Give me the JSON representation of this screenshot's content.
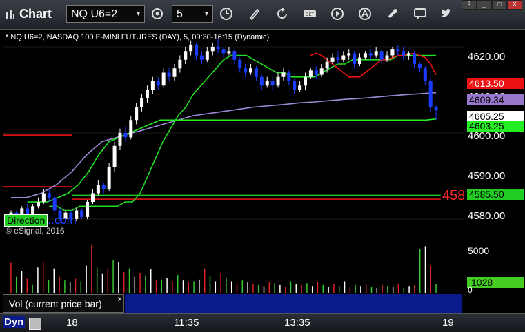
{
  "toolbar": {
    "app_title": "Chart",
    "symbol_value": "NQ U6=2",
    "interval_value": "5",
    "icons": [
      "settings-icon",
      "clock-icon",
      "pencil-icon",
      "refresh-icon",
      "get-icon",
      "play-icon",
      "alert-icon",
      "link-icon",
      "comment-icon",
      "twitter-icon"
    ]
  },
  "window_controls": [
    "?",
    "_",
    "□",
    "X"
  ],
  "legend": {
    "header": "* NQ U6=2, NASDAQ 100 E-MINI FUTURES (DAY), 5, 09:30-16:15 (Dynamic)",
    "copyright": "© eSignal, 2016",
    "watermark_box": "Direction",
    "watermark_tail": "..com"
  },
  "price_axis": {
    "labels": [
      "4620.00",
      "4610.00",
      "4600.00",
      "4590.00",
      "4580.00"
    ],
    "tags": [
      {
        "text": "4613.50",
        "bg": "#ee1111",
        "fg": "#ffffff"
      },
      {
        "text": "4609.34",
        "bg": "#9977cc",
        "fg": "#000000"
      },
      {
        "text": "4605.25",
        "bg": "#ffffff",
        "fg": "#000000"
      },
      {
        "text": "4603.25",
        "bg": "#22ee22",
        "fg": "#000000"
      },
      {
        "text": "4585.50",
        "bg": "#22cc22",
        "fg": "#000000"
      }
    ],
    "side_number": "458"
  },
  "volume_axis": {
    "top_label": "5000",
    "value_tag": "1028",
    "zero_label": "0"
  },
  "bottom": {
    "volume_tab": "Vol (current price bar)",
    "close": "×",
    "dyn": "Dyn",
    "times": [
      "18",
      "11:35",
      "13:35",
      "19"
    ]
  },
  "chart_data": {
    "type": "candlestick",
    "ylim": [
      4576,
      4624
    ],
    "ticks": [
      4620,
      4610,
      4600,
      4590,
      4580
    ],
    "levels": [
      {
        "price": 4599.5,
        "color": "#cc1111",
        "from": 0.0,
        "to": 0.15
      },
      {
        "price": 4587.5,
        "color": "#cc1111",
        "from": 0.0,
        "to": 0.15
      },
      {
        "price": 4585.5,
        "color": "#22cc22",
        "from": 0.15,
        "to": 0.95
      },
      {
        "price": 4584.6,
        "color": "#cc1111",
        "from": 0.15,
        "to": 0.95
      }
    ],
    "candles": [
      {
        "o": 4580.5,
        "c": 4581.5,
        "h": 4582,
        "l": 4580
      },
      {
        "o": 4581.5,
        "c": 4580.5,
        "h": 4582,
        "l": 4579.5
      },
      {
        "o": 4580.5,
        "c": 4582.5,
        "h": 4583,
        "l": 4580
      },
      {
        "o": 4582.5,
        "c": 4581,
        "h": 4583.5,
        "l": 4580.5
      },
      {
        "o": 4581,
        "c": 4583,
        "h": 4583.5,
        "l": 4580.5
      },
      {
        "o": 4583,
        "c": 4584,
        "h": 4585,
        "l": 4582.5
      },
      {
        "o": 4584,
        "c": 4586,
        "h": 4587,
        "l": 4583.5
      },
      {
        "o": 4586,
        "c": 4585,
        "h": 4587,
        "l": 4584
      },
      {
        "o": 4585,
        "c": 4582,
        "h": 4585.5,
        "l": 4581
      },
      {
        "o": 4582,
        "c": 4580,
        "h": 4582.5,
        "l": 4579
      },
      {
        "o": 4580,
        "c": 4581.5,
        "h": 4582,
        "l": 4579.5
      },
      {
        "o": 4581.5,
        "c": 4580,
        "h": 4582,
        "l": 4579
      },
      {
        "o": 4580,
        "c": 4582,
        "h": 4582.5,
        "l": 4579.5
      },
      {
        "o": 4582,
        "c": 4580.5,
        "h": 4582.5,
        "l": 4580
      },
      {
        "o": 4580.5,
        "c": 4584,
        "h": 4584.5,
        "l": 4580
      },
      {
        "o": 4584,
        "c": 4586,
        "h": 4587,
        "l": 4583.5
      },
      {
        "o": 4586,
        "c": 4588,
        "h": 4589,
        "l": 4585.5
      },
      {
        "o": 4588,
        "c": 4587,
        "h": 4588.5,
        "l": 4586
      },
      {
        "o": 4587,
        "c": 4592,
        "h": 4593,
        "l": 4586.5
      },
      {
        "o": 4592,
        "c": 4597,
        "h": 4598,
        "l": 4591
      },
      {
        "o": 4597,
        "c": 4600,
        "h": 4601,
        "l": 4596
      },
      {
        "o": 4600,
        "c": 4599,
        "h": 4601.5,
        "l": 4598
      },
      {
        "o": 4599,
        "c": 4603,
        "h": 4604,
        "l": 4598.5
      },
      {
        "o": 4603,
        "c": 4606,
        "h": 4607,
        "l": 4602
      },
      {
        "o": 4606,
        "c": 4608,
        "h": 4609,
        "l": 4605
      },
      {
        "o": 4608,
        "c": 4610,
        "h": 4611,
        "l": 4607
      },
      {
        "o": 4610,
        "c": 4612,
        "h": 4613,
        "l": 4609
      },
      {
        "o": 4612,
        "c": 4611,
        "h": 4613,
        "l": 4610
      },
      {
        "o": 4611,
        "c": 4614,
        "h": 4615,
        "l": 4610.5
      },
      {
        "o": 4614,
        "c": 4613,
        "h": 4615,
        "l": 4612
      },
      {
        "o": 4613,
        "c": 4615,
        "h": 4616,
        "l": 4612
      },
      {
        "o": 4615,
        "c": 4617,
        "h": 4618,
        "l": 4614
      },
      {
        "o": 4617,
        "c": 4619,
        "h": 4620,
        "l": 4616
      },
      {
        "o": 4619,
        "c": 4620.5,
        "h": 4621.5,
        "l": 4618
      },
      {
        "o": 4620.5,
        "c": 4618,
        "h": 4621,
        "l": 4617
      },
      {
        "o": 4618,
        "c": 4617,
        "h": 4619,
        "l": 4616
      },
      {
        "o": 4617,
        "c": 4619,
        "h": 4620,
        "l": 4616.5
      },
      {
        "o": 4619,
        "c": 4620,
        "h": 4621,
        "l": 4618
      },
      {
        "o": 4620,
        "c": 4619.5,
        "h": 4622,
        "l": 4618.5
      },
      {
        "o": 4619.5,
        "c": 4618.5,
        "h": 4620,
        "l": 4617.5
      },
      {
        "o": 4618.5,
        "c": 4619,
        "h": 4620,
        "l": 4618
      },
      {
        "o": 4619,
        "c": 4617,
        "h": 4619.5,
        "l": 4616
      },
      {
        "o": 4617,
        "c": 4615,
        "h": 4617.5,
        "l": 4614
      },
      {
        "o": 4615,
        "c": 4614,
        "h": 4616,
        "l": 4613
      },
      {
        "o": 4614,
        "c": 4615,
        "h": 4616,
        "l": 4613.5
      },
      {
        "o": 4615,
        "c": 4613,
        "h": 4615.5,
        "l": 4612
      },
      {
        "o": 4613,
        "c": 4611,
        "h": 4613.5,
        "l": 4610
      },
      {
        "o": 4611,
        "c": 4612,
        "h": 4613,
        "l": 4610.5
      },
      {
        "o": 4612,
        "c": 4611,
        "h": 4613,
        "l": 4610
      },
      {
        "o": 4611,
        "c": 4613,
        "h": 4614,
        "l": 4610.5
      },
      {
        "o": 4613,
        "c": 4614,
        "h": 4615,
        "l": 4612
      },
      {
        "o": 4614,
        "c": 4612,
        "h": 4614.5,
        "l": 4611
      },
      {
        "o": 4612,
        "c": 4610,
        "h": 4612.5,
        "l": 4609
      },
      {
        "o": 4610,
        "c": 4611,
        "h": 4612,
        "l": 4609.5
      },
      {
        "o": 4611,
        "c": 4613,
        "h": 4614,
        "l": 4610
      },
      {
        "o": 4613,
        "c": 4614.5,
        "h": 4615,
        "l": 4612.5
      },
      {
        "o": 4614.5,
        "c": 4613.5,
        "h": 4615.5,
        "l": 4612.5
      },
      {
        "o": 4613.5,
        "c": 4615,
        "h": 4616,
        "l": 4613
      },
      {
        "o": 4615,
        "c": 4616.5,
        "h": 4617.5,
        "l": 4614
      },
      {
        "o": 4616.5,
        "c": 4617.5,
        "h": 4618.5,
        "l": 4616
      },
      {
        "o": 4617.5,
        "c": 4617,
        "h": 4619,
        "l": 4616
      },
      {
        "o": 4617,
        "c": 4618,
        "h": 4619,
        "l": 4616.5
      },
      {
        "o": 4618,
        "c": 4618.5,
        "h": 4619.5,
        "l": 4617
      },
      {
        "o": 4618.5,
        "c": 4616,
        "h": 4619,
        "l": 4615
      },
      {
        "o": 4616,
        "c": 4617.5,
        "h": 4618.5,
        "l": 4615.5
      },
      {
        "o": 4617.5,
        "c": 4618.5,
        "h": 4619,
        "l": 4617
      },
      {
        "o": 4618.5,
        "c": 4618,
        "h": 4619.5,
        "l": 4617
      },
      {
        "o": 4618,
        "c": 4619,
        "h": 4620,
        "l": 4617.5
      },
      {
        "o": 4619,
        "c": 4617,
        "h": 4619.5,
        "l": 4616
      },
      {
        "o": 4617,
        "c": 4618,
        "h": 4619,
        "l": 4616.5
      },
      {
        "o": 4618,
        "c": 4619.5,
        "h": 4620,
        "l": 4617.5
      },
      {
        "o": 4619.5,
        "c": 4619,
        "h": 4620.5,
        "l": 4618
      },
      {
        "o": 4619,
        "c": 4618,
        "h": 4620,
        "l": 4617
      },
      {
        "o": 4618,
        "c": 4618.5,
        "h": 4619,
        "l": 4617
      },
      {
        "o": 4618.5,
        "c": 4616,
        "h": 4619,
        "l": 4615
      },
      {
        "o": 4616,
        "c": 4615,
        "h": 4616.5,
        "l": 4614
      },
      {
        "o": 4615,
        "c": 4612,
        "h": 4615.5,
        "l": 4611
      },
      {
        "o": 4612,
        "c": 4606,
        "h": 4612.5,
        "l": 4605
      },
      {
        "o": 4606,
        "c": 4605.25,
        "h": 4606.5,
        "l": 4603
      }
    ],
    "volume": {
      "ymax": 5500,
      "values": [
        3300,
        1800,
        2400,
        1600,
        900,
        2800,
        3400,
        1500,
        2700,
        1800,
        1400,
        1200,
        1600,
        1300,
        3000,
        5200,
        2800,
        2100,
        2700,
        3600,
        3400,
        2300,
        2700,
        1800,
        2200,
        1900,
        2600,
        1400,
        1500,
        1700,
        1300,
        2000,
        1400,
        1200,
        1300,
        1500,
        2700,
        1900,
        1300,
        2200,
        1700,
        1300,
        1100,
        1400,
        1200,
        1000,
        900,
        800,
        1200,
        1100,
        900,
        700,
        1300,
        1000,
        900,
        1100,
        800,
        1200,
        900,
        700,
        1000,
        800,
        1300,
        700,
        900,
        800,
        1000,
        700,
        600,
        900,
        800,
        700,
        1000,
        600,
        800,
        900,
        4800,
        5100,
        3000,
        1028
      ]
    },
    "ma_green_fast": [
      4583,
      4583,
      4582,
      4582,
      4583,
      4583,
      4583,
      4583,
      4583,
      4583,
      4584,
      4584,
      4586,
      4590,
      4594,
      4598,
      4601,
      4604,
      4606,
      4609,
      4611,
      4613,
      4615,
      4617,
      4618,
      4618,
      4618,
      4617,
      4616,
      4615,
      4614,
      4614,
      4613,
      4613,
      4613,
      4613,
      4614,
      4615,
      4616,
      4616,
      4617,
      4617,
      4617,
      4617,
      4617,
      4617,
      4618,
      4618,
      4618,
      4618,
      4618,
      4618
    ],
    "ma_green_slow": [
      4584,
      4584,
      4584,
      4585,
      4586,
      4588,
      4591,
      4595,
      4598,
      4599,
      4600,
      4601,
      4602,
      4603,
      4603,
      4603,
      4603,
      4603,
      4603,
      4603,
      4603,
      4603,
      4603,
      4603,
      4603,
      4603,
      4603,
      4603,
      4603,
      4603,
      4603,
      4603,
      4603,
      4603,
      4603,
      4603,
      4603,
      4603,
      4603,
      4603,
      4603.25
    ],
    "ma_purple": [
      4585,
      4585,
      4586,
      4588,
      4591,
      4595,
      4598,
      4599,
      4600,
      4601,
      4602,
      4603,
      4604,
      4604.5,
      4605,
      4605.5,
      4606,
      4606.3,
      4606.6,
      4607,
      4607.2,
      4607.5,
      4607.8,
      4608,
      4608.3,
      4608.6,
      4608.9,
      4609.1,
      4609.34
    ],
    "ma_red": [
      4618,
      4618.5,
      4618,
      4617,
      4616,
      4615,
      4614,
      4613,
      4613,
      4613,
      4614,
      4615,
      4616,
      4617,
      4617,
      4617.5,
      4618,
      4618,
      4618.3,
      4618.5,
      4618,
      4617.5,
      4616,
      4613.5
    ]
  }
}
